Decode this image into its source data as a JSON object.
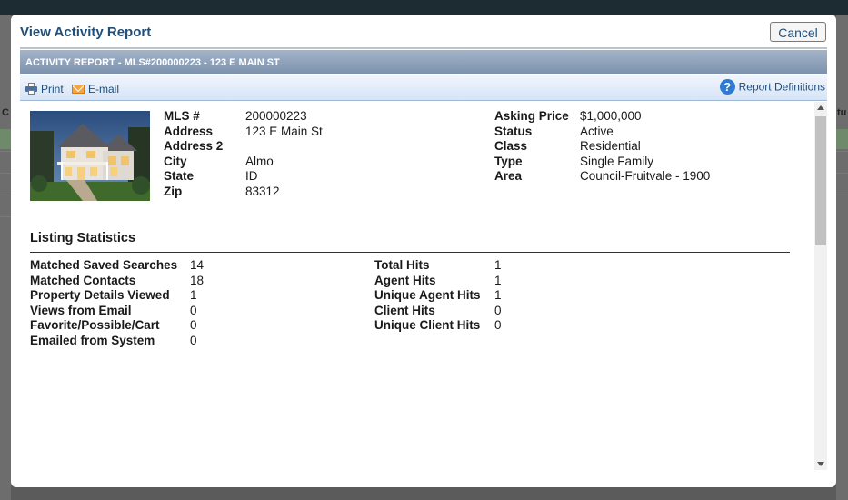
{
  "background": {
    "left_label": "C",
    "right_label": "tu"
  },
  "modal": {
    "title": "View Activity Report",
    "cancel_label": "Cancel"
  },
  "report_bar": {
    "text": "ACTIVITY REPORT - MLS#200000223 - 123 E MAIN ST"
  },
  "toolbar": {
    "print_label": "Print",
    "print_icon": "printer-icon",
    "email_label": "E-mail",
    "email_icon": "envelope-icon",
    "definitions_label": "Report Definitions",
    "definitions_icon": "help-icon"
  },
  "listing": {
    "left": [
      {
        "label": "MLS #",
        "value": "200000223"
      },
      {
        "label": "Address",
        "value": "123 E Main St"
      },
      {
        "label": "Address 2",
        "value": ""
      },
      {
        "label": "City",
        "value": "Almo"
      },
      {
        "label": "State",
        "value": "ID"
      },
      {
        "label": "Zip",
        "value": "83312"
      }
    ],
    "right": [
      {
        "label": "Asking Price",
        "value": "$1,000,000"
      },
      {
        "label": "Status",
        "value": "Active"
      },
      {
        "label": "Class",
        "value": "Residential"
      },
      {
        "label": "Type",
        "value": "Single Family"
      },
      {
        "label": "Area",
        "value": "Council-Fruitvale - 1900"
      }
    ]
  },
  "stats": {
    "heading": "Listing Statistics",
    "left": [
      {
        "label": "Matched Saved Searches",
        "value": "14"
      },
      {
        "label": "Matched Contacts",
        "value": "18"
      },
      {
        "label": "Property Details Viewed",
        "value": "1"
      },
      {
        "label": "Views from Email",
        "value": "0"
      },
      {
        "label": "Favorite/Possible/Cart",
        "value": "0"
      },
      {
        "label": "Emailed from System",
        "value": "0"
      }
    ],
    "right": [
      {
        "label": "Total Hits",
        "value": "1"
      },
      {
        "label": "Agent Hits",
        "value": "1"
      },
      {
        "label": "Unique Agent Hits",
        "value": "1"
      },
      {
        "label": "Client Hits",
        "value": "0"
      },
      {
        "label": "Unique Client Hits",
        "value": "0"
      }
    ]
  },
  "colors": {
    "title": "#1f4e79",
    "report_bar": "#8a9db5",
    "toolbar": "#dde8f6"
  }
}
